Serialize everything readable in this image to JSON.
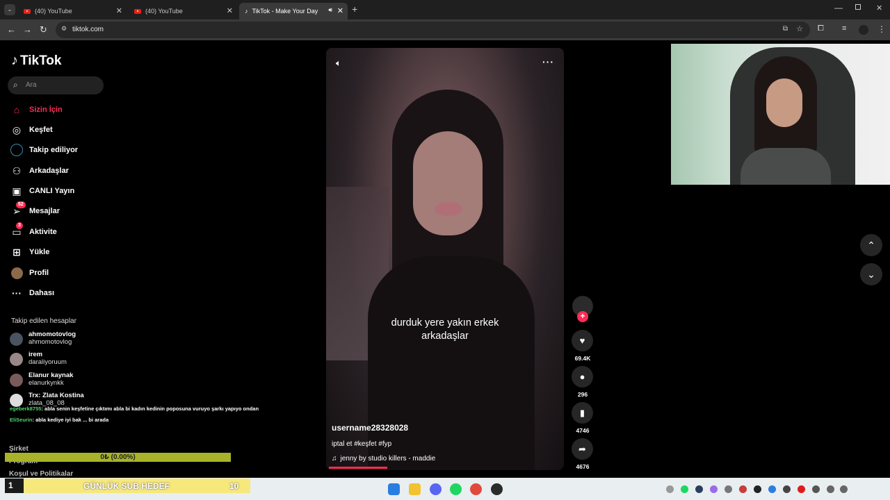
{
  "browser": {
    "tabs": [
      {
        "label": "(40) YouTube"
      },
      {
        "label": "(40) YouTube"
      },
      {
        "label": "TikTok - Make Your Day"
      }
    ],
    "url": "tiktok.com"
  },
  "tiktok": {
    "logo": "TikTok",
    "search_placeholder": "Ara",
    "nav": [
      {
        "label": "Sizin İçin",
        "icon": "home-icon"
      },
      {
        "label": "Keşfet",
        "icon": "compass-icon"
      },
      {
        "label": "Takip ediliyor",
        "icon": "following-icon"
      },
      {
        "label": "Arkadaşlar",
        "icon": "friends-icon"
      },
      {
        "label": "CANLI Yayın",
        "icon": "live-icon"
      },
      {
        "label": "Mesajlar",
        "icon": "messages-icon",
        "badge": "52"
      },
      {
        "label": "Aktivite",
        "icon": "activity-icon",
        "badge": "3"
      },
      {
        "label": "Yükle",
        "icon": "upload-icon"
      },
      {
        "label": "Profil",
        "icon": "profile-icon"
      },
      {
        "label": "Dahası",
        "icon": "more-icon"
      }
    ],
    "following_title": "Takip edilen hesaplar",
    "accounts": [
      {
        "name": "ahmomotovlog",
        "handle": "ahmomotovlog"
      },
      {
        "name": "irem",
        "handle": "daraliyoruum"
      },
      {
        "name": "Elanur kaynak",
        "handle": "elanurkynkk"
      },
      {
        "name": "Trx: Zlata Kostina",
        "handle": "zlata_08_08"
      }
    ],
    "footer": [
      "Şirket",
      "Program",
      "Koşul ve Politikalar"
    ],
    "video": {
      "caption": "durduk yere yakın erkek arkadaşlar",
      "username": "username28328028",
      "description": "iptal et #keşfet #fyp",
      "music": "jenny by studio killers - maddie",
      "progress_fraction": 0.25
    },
    "actions": {
      "likes": "69.4K",
      "comments": "296",
      "saves": "4746",
      "shares": "4676"
    }
  },
  "stream_overlay": {
    "chat": [
      {
        "user": "egeberk8755",
        "text": ": abla senin keşfetine çıktımı abla bi kadın kedinin poposuna vuruyo şarkı yapıyo ondan"
      },
      {
        "user": "EliSeurin",
        "text": ": abla kediye iyi bak ... bi arada"
      }
    ],
    "sub_progress": "0₺ (0.00%)",
    "goal_number": "1",
    "goal_label": "GÜNLÜK SUB HEDEF",
    "goal_target": "10"
  },
  "colors": {
    "accent": "#fe2c55",
    "background": "#000000",
    "goal_bar": "#f7e87c",
    "sub_bar": "#a8b32a"
  }
}
